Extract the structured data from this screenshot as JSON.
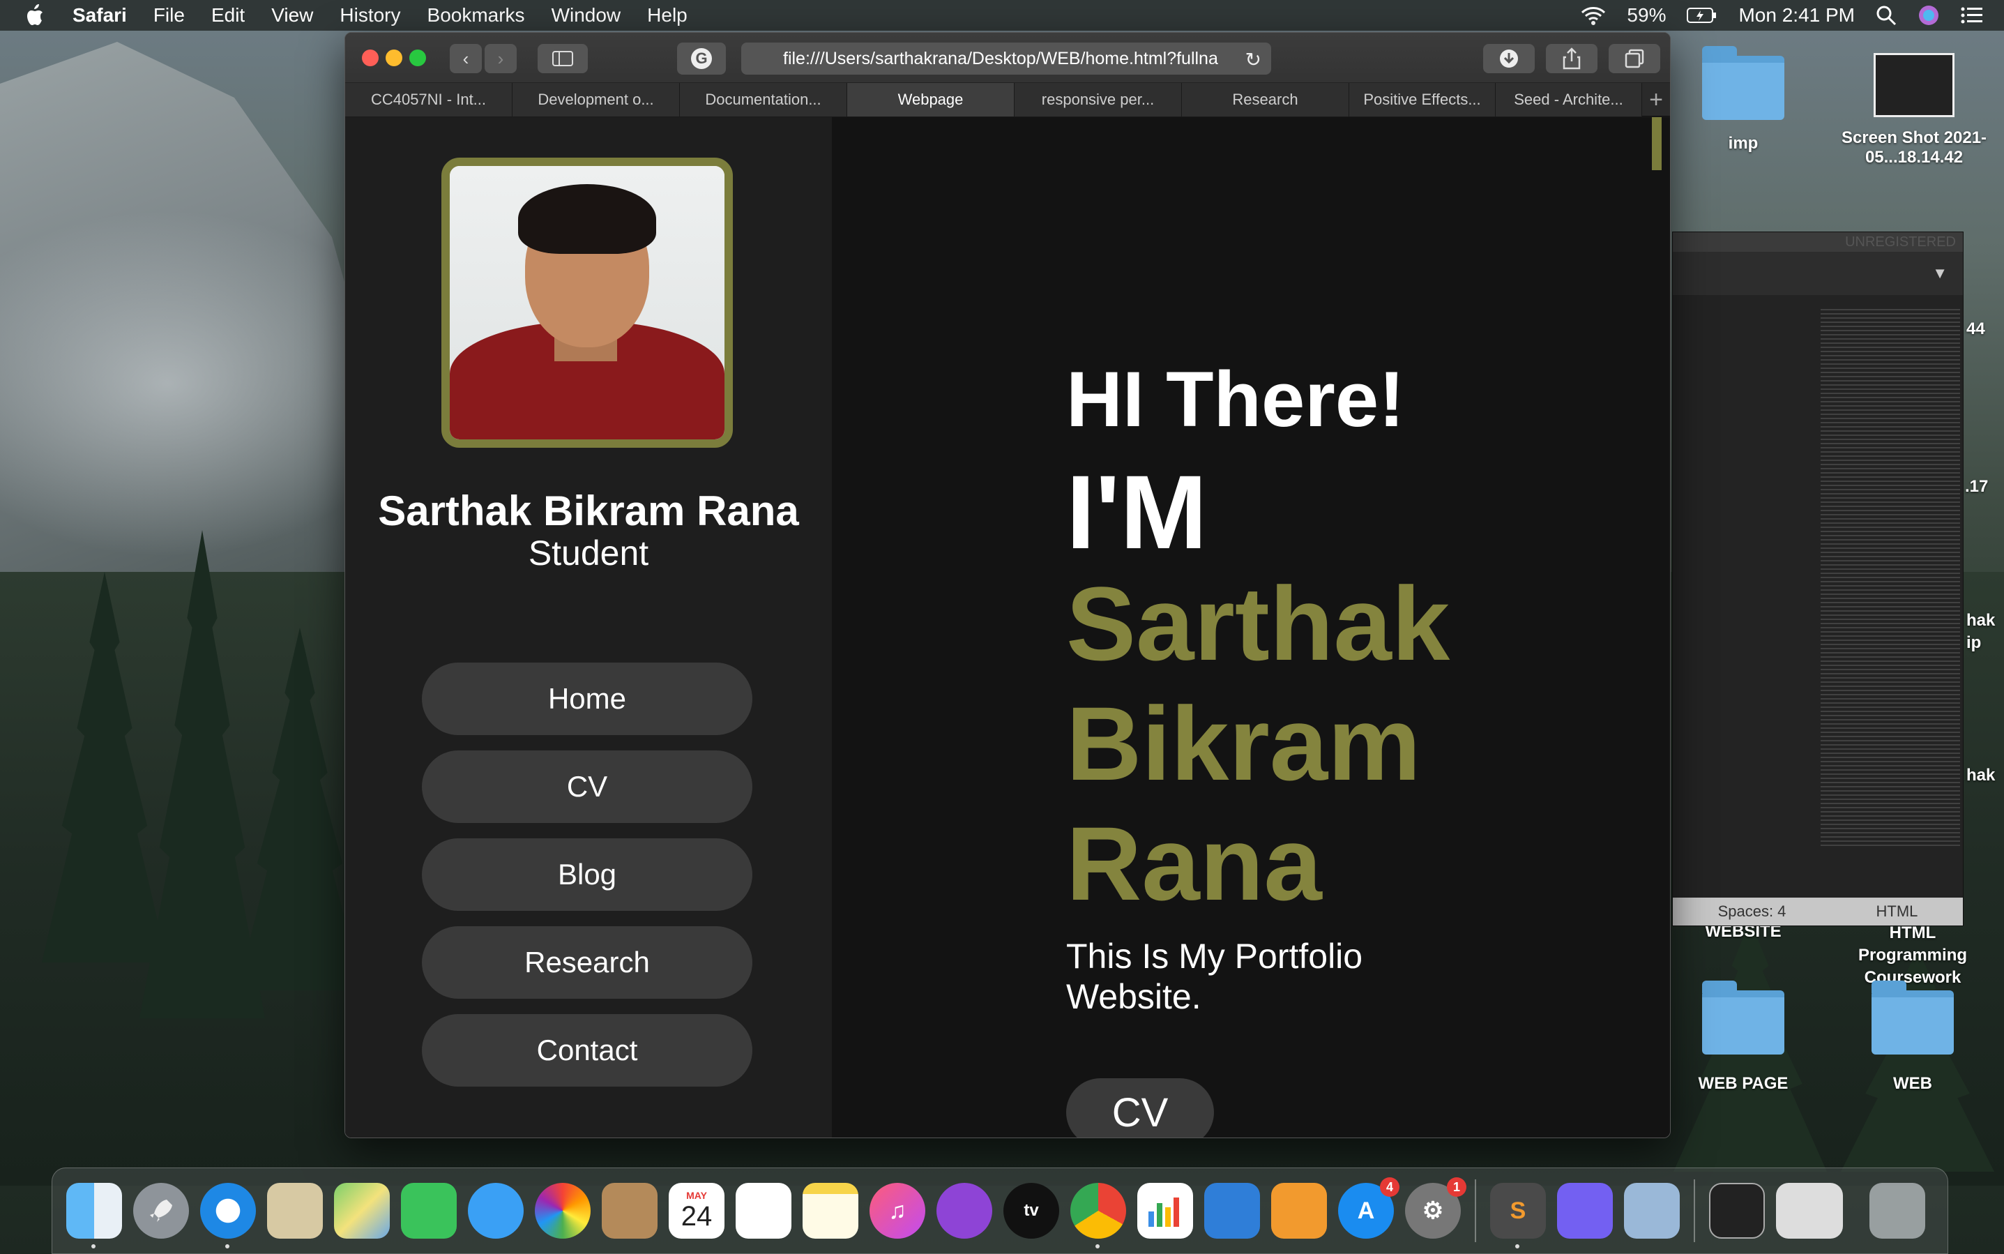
{
  "menubar": {
    "app_name": "Safari",
    "items": [
      "File",
      "Edit",
      "View",
      "History",
      "Bookmarks",
      "Window",
      "Help"
    ],
    "battery": "59%",
    "clock": "Mon 2:41 PM"
  },
  "browser": {
    "url": "file:///Users/sarthakrana/Desktop/WEB/home.html?fullna",
    "tabs": [
      {
        "label": "CC4057NI - Int..."
      },
      {
        "label": "Development o..."
      },
      {
        "label": "Documentation..."
      },
      {
        "label": "Webpage",
        "active": true
      },
      {
        "label": "responsive per..."
      },
      {
        "label": "Research"
      },
      {
        "label": "Positive Effects..."
      },
      {
        "label": "Seed - Archite..."
      }
    ]
  },
  "profile": {
    "name": "Sarthak Bikram Rana",
    "role": "Student"
  },
  "nav": {
    "items": [
      "Home",
      "CV",
      "Blog",
      "Research",
      "Contact"
    ]
  },
  "hero": {
    "greeting": "HI There!",
    "intro": "I'M",
    "name_lines": [
      "Sarthak",
      "Bikram",
      "Rana"
    ],
    "description": "This Is My Portfolio Website.",
    "cta": "CV"
  },
  "desktop": {
    "icons": [
      {
        "label": "imp"
      },
      {
        "label": "Screen Shot 2021-05...18.14.42"
      },
      {
        "label": "WEBSITE"
      },
      {
        "label": "HTML Programming Coursework"
      },
      {
        "label": "WEB PAGE"
      },
      {
        "label": "WEB"
      }
    ],
    "side_snippets": [
      "44",
      ".17",
      "hak",
      "ip",
      "hak"
    ]
  },
  "editor": {
    "title": "UNREGISTERED",
    "spaces": "Spaces: 4",
    "syntax": "HTML"
  },
  "dock": {
    "calendar_month": "MAY",
    "calendar_day": "24",
    "appstore_badge": "4",
    "settings_badge": "1"
  },
  "colors": {
    "accent_olive": "#84843e",
    "frame_olive": "#7b7d3c",
    "sidebar_bg": "#1e1e1e",
    "main_bg": "#131313",
    "button_bg": "#3a3a3a"
  }
}
